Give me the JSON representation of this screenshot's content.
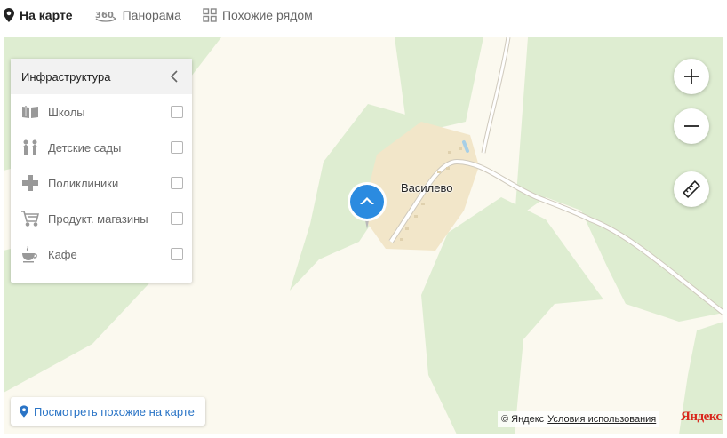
{
  "tabs": [
    {
      "label": "На карте",
      "icon": "map-pin-icon",
      "active": true
    },
    {
      "label": "Панорама",
      "icon": "panorama-360-icon",
      "active": false
    },
    {
      "label": "Похожие рядом",
      "icon": "grid-icon",
      "active": false
    }
  ],
  "map": {
    "place_name": "Василево",
    "colors": {
      "background": "#fbf9ef",
      "forest": "#deedd1",
      "settlement": "#f2e6c9",
      "road": "#ffffff",
      "marker": "#2b8be0"
    }
  },
  "infrastructure": {
    "title": "Инфраструктура",
    "items": [
      {
        "label": "Школы",
        "icon": "book-icon",
        "checked": false
      },
      {
        "label": "Детские сады",
        "icon": "children-icon",
        "checked": false
      },
      {
        "label": "Поликлиники",
        "icon": "medical-cross-icon",
        "checked": false
      },
      {
        "label": "Продукт. магазины",
        "icon": "shopping-cart-icon",
        "checked": false
      },
      {
        "label": "Кафе",
        "icon": "coffee-cup-icon",
        "checked": false
      }
    ]
  },
  "controls": {
    "zoom_in": "+",
    "zoom_out": "−",
    "ruler": "ruler-icon"
  },
  "similar_button": {
    "label": "Посмотреть похожие на карте",
    "icon": "map-pin-icon"
  },
  "copyright": {
    "text": "© Яндекс",
    "terms": "Условия использования",
    "logo": "Яндекс"
  }
}
